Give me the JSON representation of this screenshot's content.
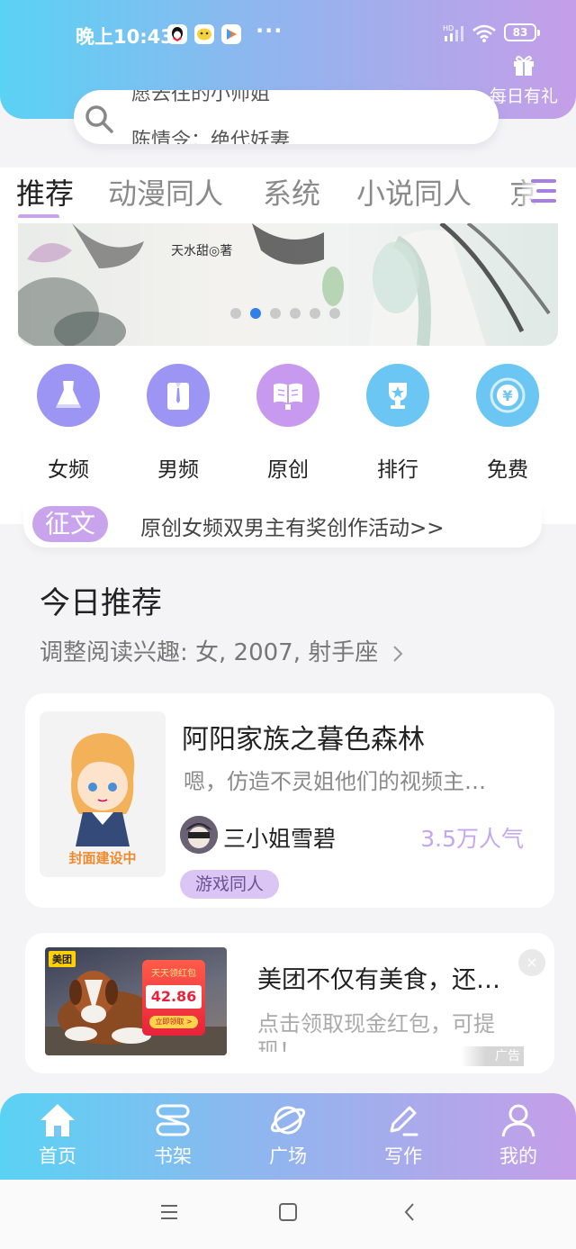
{
  "status_bar": {
    "time": "晚上10:43",
    "dots": "···",
    "network": "HD",
    "battery": "83"
  },
  "header": {
    "gift_label": "每日有礼",
    "search": {
      "hint_prev": "愿去往的小师姐",
      "hint_current": "陈情令：绝代妖妻"
    }
  },
  "tabs": {
    "items": [
      "推荐",
      "动漫同人",
      "系统",
      "小说同人",
      "京"
    ],
    "active": "推荐"
  },
  "banner": {
    "author_caption": "天水甜◎著",
    "slide_count": 6,
    "active_slide": 2
  },
  "entries": [
    {
      "label": "女频",
      "icon": "dress-icon",
      "color": "#9c95f3"
    },
    {
      "label": "男频",
      "icon": "shirt-tie-icon",
      "color": "#9c95f3"
    },
    {
      "label": "原创",
      "icon": "book-icon",
      "color": "#c79af0"
    },
    {
      "label": "排行",
      "icon": "trophy-icon",
      "color": "#6bc6f4"
    },
    {
      "label": "免费",
      "icon": "yuan-coin-icon",
      "color": "#6bc6f4"
    }
  ],
  "contest": {
    "tag": "征文",
    "text": "原创女频双男主有奖创作活动>>"
  },
  "today": {
    "title": "今日推荐",
    "subtitle": "调整阅读兴趣: 女, 2007, 射手座",
    "book": {
      "title": "阿阳家族之暮色森林",
      "description": "嗯，仿造不灵姐他们的视频主…",
      "cover_text": "封面建设中",
      "author": "三小姐雪碧",
      "popularity": "3.5万人气",
      "genre": "游戏同人"
    }
  },
  "ad": {
    "brand": "美团",
    "redpack_top": "天天领红包",
    "amount": "42.86",
    "redpack_button": "立即领取 >",
    "title": "美团不仅有美食，还…",
    "description": "点击领取现金红包，可提现！",
    "label": "广告",
    "close": "×"
  },
  "bottom_nav": [
    {
      "label": "首页",
      "icon": "home-icon",
      "active": true
    },
    {
      "label": "书架",
      "icon": "bookshelf-icon",
      "active": false
    },
    {
      "label": "广场",
      "icon": "planet-icon",
      "active": false
    },
    {
      "label": "写作",
      "icon": "pen-icon",
      "active": false
    },
    {
      "label": "我的",
      "icon": "user-icon",
      "active": false
    }
  ],
  "colors": {
    "gradient_start": "#5ad2f4",
    "gradient_end": "#c59ee8",
    "accent_purple": "#c9a4ec",
    "banner_dot_active": "#2f80e8"
  }
}
